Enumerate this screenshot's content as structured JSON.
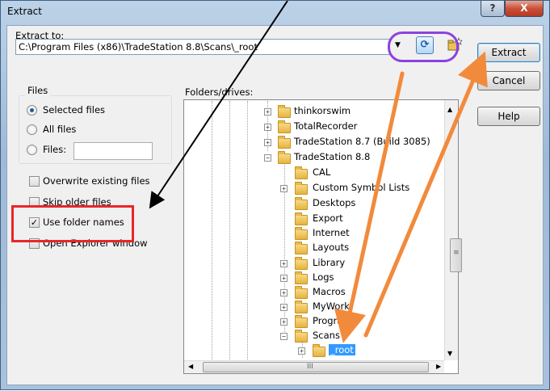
{
  "window": {
    "title": "Extract",
    "help_glyph": "?",
    "close_glyph": "X"
  },
  "extract_to": {
    "label": "Extract to:",
    "path": "C:\\Program Files (x86)\\TradeStation 8.8\\Scans\\_root"
  },
  "buttons": {
    "extract": "Extract",
    "cancel": "Cancel",
    "help": "Help"
  },
  "files_group": {
    "title": "Files",
    "options": [
      "Selected files",
      "All files",
      "Files:"
    ],
    "selected": "Selected files"
  },
  "checkboxes": [
    {
      "label": "Overwrite existing files",
      "checked": false
    },
    {
      "label": "Skip older files",
      "checked": false
    },
    {
      "label": "Use folder names",
      "checked": true
    },
    {
      "label": "Open Explorer window",
      "checked": false
    }
  ],
  "folders_label": "Folders/drives:",
  "tree": {
    "items": [
      "thinkorswim",
      "TotalRecorder",
      "TradeStation 8.7 (Build 3085)",
      "TradeStation 8.8",
      "CAL",
      "Custom Symbol Lists",
      "Desktops",
      "Export",
      "Internet",
      "Layouts",
      "Library",
      "Logs",
      "Macros",
      "MyWork",
      "Program",
      "Scans",
      "_root"
    ]
  },
  "glyphs": {
    "expand": "+",
    "collapse": "−",
    "dropdown": "▼",
    "hscroll_grip": "III",
    "vscroll_grip": "≡",
    "check_mark": "✓",
    "refresh": "⟳"
  },
  "annotation_colors": {
    "highlight_ellipse": "#8b42e0",
    "highlight_box": "#e8262a",
    "arrow_orange": "#f28a3c",
    "arrow_black": "#000000"
  }
}
